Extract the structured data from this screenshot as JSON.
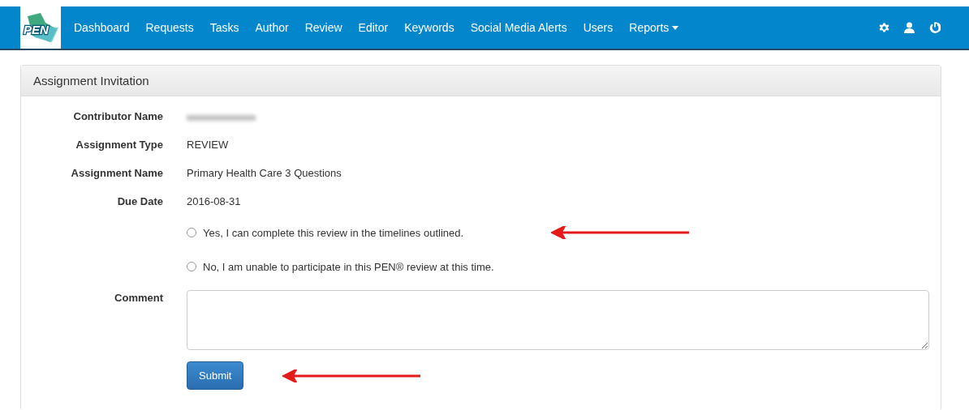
{
  "navbar": {
    "logo": "PEN",
    "items": [
      {
        "label": "Dashboard",
        "dropdown": false
      },
      {
        "label": "Requests",
        "dropdown": false
      },
      {
        "label": "Tasks",
        "dropdown": false
      },
      {
        "label": "Author",
        "dropdown": false
      },
      {
        "label": "Review",
        "dropdown": false
      },
      {
        "label": "Editor",
        "dropdown": false
      },
      {
        "label": "Keywords",
        "dropdown": false
      },
      {
        "label": "Social Media Alerts",
        "dropdown": false
      },
      {
        "label": "Users",
        "dropdown": false
      },
      {
        "label": "Reports",
        "dropdown": true
      }
    ]
  },
  "panel": {
    "title": "Assignment Invitation",
    "fields": [
      {
        "label": "Contributor Name",
        "kind": "redacted"
      },
      {
        "label": "Assignment Type",
        "kind": "text",
        "value": "REVIEW"
      },
      {
        "label": "Assignment Name",
        "kind": "text",
        "value": "Primary Health Care 3 Questions"
      },
      {
        "label": "Due Date",
        "kind": "text",
        "value": "2016-08-31"
      }
    ],
    "options": [
      {
        "label": "Yes, I can complete this review in the timelines outlined.",
        "selected": false,
        "flagged": true
      },
      {
        "label": "No, I am unable to participate in this PEN® review at this time.",
        "selected": false,
        "flagged": false
      }
    ],
    "comment": {
      "label": "Comment"
    },
    "submit": {
      "label": "Submit",
      "flagged": true
    }
  }
}
